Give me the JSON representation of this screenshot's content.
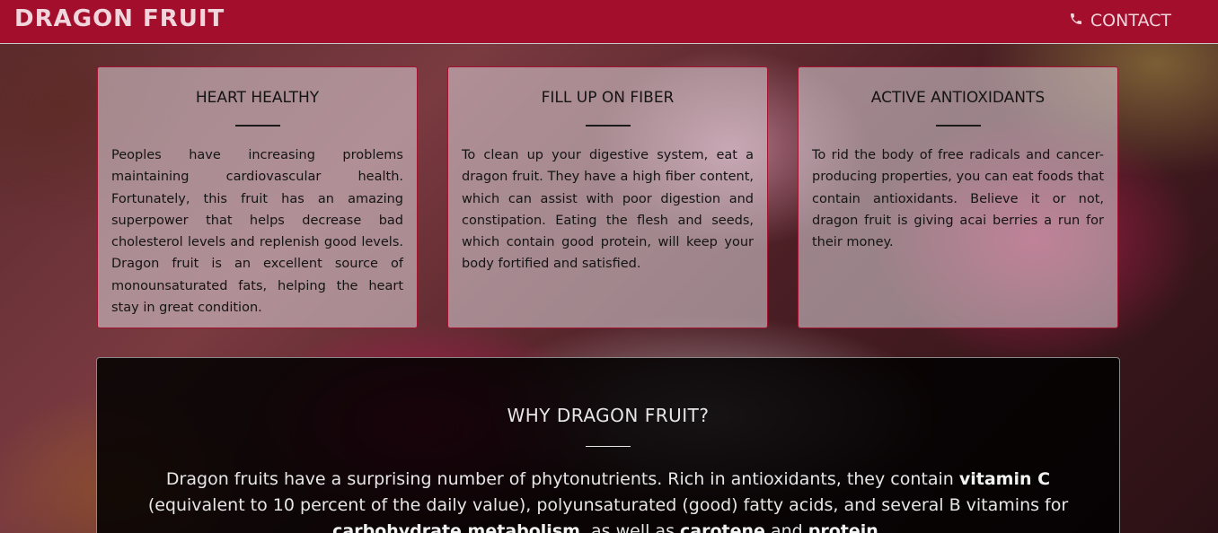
{
  "header": {
    "brand": "DRAGON FRUIT",
    "contact_label": "CONTACT",
    "contact_icon": "phone-icon",
    "background_color": "#a30e2c"
  },
  "cards": [
    {
      "title": "HEART HEALTHY",
      "body": "Peoples have increasing problems maintaining cardiovascular health. Fortunately, this fruit has an amazing superpower that helps decrease bad cholesterol levels and replenish good levels. Dragon fruit is an excellent source of monounsaturated fats, helping the heart stay in great condition."
    },
    {
      "title": "FILL UP ON FIBER",
      "body": "To clean up your digestive system, eat a dragon fruit. They have a high fiber content, which can assist with poor digestion and constipation. Eating the flesh and seeds, which contain good protein, will keep your body fortified and satisfied."
    },
    {
      "title": "ACTIVE ANTIOXIDANTS",
      "body": "To rid the body of free radicals and cancer-producing properties, you can eat foods that contain antioxidants. Believe it or not, dragon fruit is giving acai berries a run for their money."
    }
  ],
  "why": {
    "title": "WHY DRAGON FRUIT?",
    "p1": "Dragon fruits have a surprising number of phytonutrients. Rich in antioxidants, they contain ",
    "b1": "vitamin C",
    "p2": " (equivalent to 10 percent of the daily value), polyunsaturated (good) fatty acids, and several B vitamins for ",
    "b2": "carbohydrate metabolism",
    "p3": ", as well as ",
    "b3": "carotene",
    "p4": " and ",
    "b4": "protein",
    "p5": "."
  }
}
